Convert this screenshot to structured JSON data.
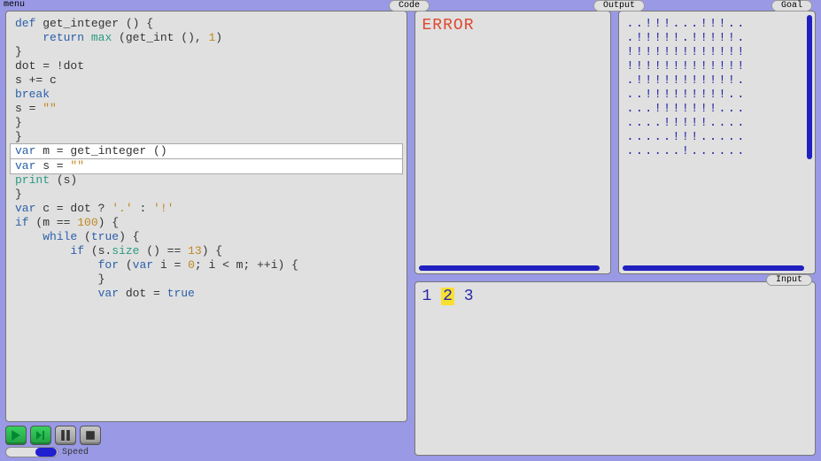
{
  "menu_label": "menu",
  "labels": {
    "code": "Code",
    "output": "Output",
    "goal": "Goal",
    "input": "Input",
    "speed": "Speed"
  },
  "code": {
    "lines": [
      {
        "hl": false,
        "segs": [
          [
            "kw",
            "def"
          ],
          [
            "",
            " get_integer () {"
          ]
        ]
      },
      {
        "hl": false,
        "segs": [
          [
            "",
            "    "
          ],
          [
            "kw",
            "return"
          ],
          [
            "",
            " "
          ],
          [
            "fn",
            "max"
          ],
          [
            "",
            " (get_int (), "
          ],
          [
            "num",
            "1"
          ],
          [
            "",
            ")"
          ]
        ]
      },
      {
        "hl": false,
        "segs": [
          [
            "",
            "}"
          ]
        ]
      },
      {
        "hl": false,
        "segs": [
          [
            "",
            ""
          ]
        ]
      },
      {
        "hl": false,
        "segs": [
          [
            "",
            "dot = !dot"
          ]
        ]
      },
      {
        "hl": false,
        "segs": [
          [
            "",
            "s += c"
          ]
        ]
      },
      {
        "hl": false,
        "segs": [
          [
            "kw",
            "break"
          ]
        ]
      },
      {
        "hl": false,
        "segs": [
          [
            "",
            "s = "
          ],
          [
            "str",
            "\"\""
          ]
        ]
      },
      {
        "hl": false,
        "segs": [
          [
            "",
            "}"
          ]
        ]
      },
      {
        "hl": false,
        "segs": [
          [
            "",
            "}"
          ]
        ]
      },
      {
        "hl": true,
        "segs": [
          [
            "kw",
            "var"
          ],
          [
            "",
            " m = get_integer ()"
          ]
        ]
      },
      {
        "hl": true,
        "segs": [
          [
            "kw",
            "var"
          ],
          [
            "",
            " s = "
          ],
          [
            "str",
            "\"\""
          ]
        ]
      },
      {
        "hl": false,
        "segs": [
          [
            "fn",
            "print"
          ],
          [
            "",
            " (s)"
          ]
        ]
      },
      {
        "hl": false,
        "segs": [
          [
            "",
            "}"
          ]
        ]
      },
      {
        "hl": false,
        "segs": [
          [
            "kw",
            "var"
          ],
          [
            "",
            " c = dot ? "
          ],
          [
            "str",
            "'.'"
          ],
          [
            "",
            " : "
          ],
          [
            "str",
            "'!'"
          ]
        ]
      },
      {
        "hl": false,
        "segs": [
          [
            "kw",
            "if"
          ],
          [
            "",
            " (m == "
          ],
          [
            "num",
            "100"
          ],
          [
            "",
            ") {"
          ]
        ]
      },
      {
        "hl": false,
        "segs": [
          [
            "",
            "    "
          ],
          [
            "kw",
            "while"
          ],
          [
            "",
            " ("
          ],
          [
            "kw",
            "true"
          ],
          [
            "",
            ") {"
          ]
        ]
      },
      {
        "hl": false,
        "segs": [
          [
            "",
            "        "
          ],
          [
            "kw",
            "if"
          ],
          [
            "",
            " (s."
          ],
          [
            "fn",
            "size"
          ],
          [
            "",
            " () == "
          ],
          [
            "num",
            "13"
          ],
          [
            "",
            ") {"
          ]
        ]
      },
      {
        "hl": false,
        "segs": [
          [
            "",
            "            "
          ],
          [
            "kw",
            "for"
          ],
          [
            "",
            " ("
          ],
          [
            "kw",
            "var"
          ],
          [
            "",
            " i = "
          ],
          [
            "num",
            "0"
          ],
          [
            "",
            "; i < m; ++i) {"
          ]
        ]
      },
      {
        "hl": false,
        "segs": [
          [
            "",
            "            }"
          ]
        ]
      },
      {
        "hl": false,
        "segs": [
          [
            "",
            "            "
          ],
          [
            "kw",
            "var"
          ],
          [
            "",
            " dot = "
          ],
          [
            "kw",
            "true"
          ]
        ]
      }
    ]
  },
  "output": {
    "error_text": "ERROR"
  },
  "goal": {
    "rows": [
      "..!!!...!!!..",
      ".!!!!!.!!!!!.",
      "!!!!!!!!!!!!!",
      "!!!!!!!!!!!!!",
      ".!!!!!!!!!!!.",
      "..!!!!!!!!!..",
      "...!!!!!!!...",
      "....!!!!!....",
      ".....!!!.....",
      "......!......"
    ]
  },
  "input": {
    "tokens": [
      "1",
      "2",
      "3"
    ],
    "current_index": 1
  },
  "controls": {
    "play": "play-button",
    "step": "step-button",
    "pause": "pause-button",
    "stop": "stop-button"
  }
}
